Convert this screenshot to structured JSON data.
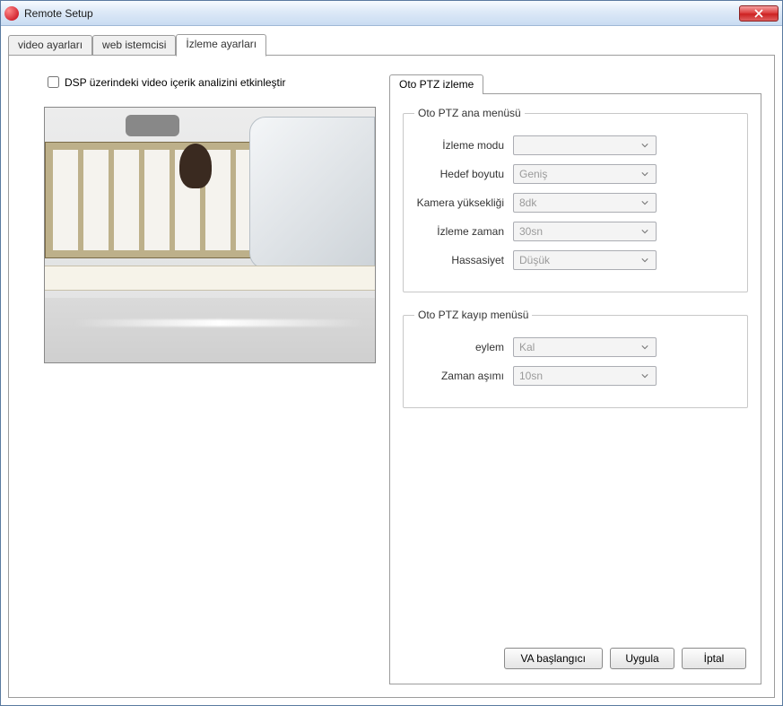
{
  "window": {
    "title": "Remote Setup"
  },
  "tabs": {
    "video": "video ayarları",
    "web": "web istemcisi",
    "tracking": "İzleme ayarları"
  },
  "left": {
    "enable_dsp_label": "DSP üzerindeki video içerik analizini etkinleştir",
    "enable_dsp_checked": false
  },
  "inner_tab": {
    "label": "Oto PTZ izleme"
  },
  "group_main": {
    "legend": "Oto PTZ ana menüsü",
    "rows": {
      "mode": {
        "label": "İzleme modu",
        "value": ""
      },
      "target": {
        "label": "Hedef boyutu",
        "value": "Geniş"
      },
      "height": {
        "label": "Kamera yüksekliği",
        "value": "8dk"
      },
      "time": {
        "label": "İzleme zaman",
        "value": "30sn"
      },
      "sens": {
        "label": "Hassasiyet",
        "value": "Düşük"
      }
    }
  },
  "group_lost": {
    "legend": "Oto PTZ kayıp menüsü",
    "rows": {
      "action": {
        "label": "eylem",
        "value": "Kal"
      },
      "timeout": {
        "label": "Zaman aşımı",
        "value": "10sn"
      }
    }
  },
  "buttons": {
    "va_start": "VA başlangıcı",
    "apply": "Uygula",
    "cancel": "İptal"
  }
}
